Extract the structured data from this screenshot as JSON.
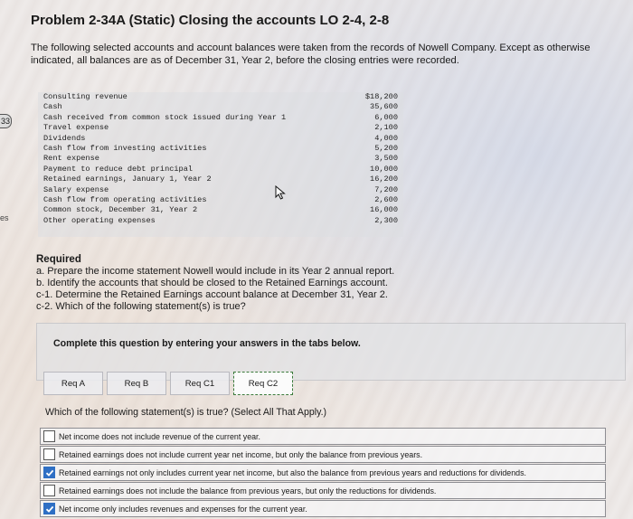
{
  "edge": {
    "num": "33",
    "label": "es"
  },
  "title": "Problem 2-34A (Static) Closing the accounts LO 2-4, 2-8",
  "intro": "The following selected accounts and account balances were taken from the records of Nowell Company. Except as otherwise indicated, all balances are as of December 31, Year 2, before the closing entries were recorded.",
  "accounts": [
    {
      "name": "Consulting revenue",
      "amount": "$18,200"
    },
    {
      "name": "Cash",
      "amount": "35,600"
    },
    {
      "name": "Cash received from common stock issued during Year 1",
      "amount": "6,000"
    },
    {
      "name": "Travel expense",
      "amount": "2,100"
    },
    {
      "name": "Dividends",
      "amount": "4,000"
    },
    {
      "name": "Cash flow from investing activities",
      "amount": "5,200"
    },
    {
      "name": "Rent expense",
      "amount": "3,500"
    },
    {
      "name": "Payment to reduce debt principal",
      "amount": "10,000"
    },
    {
      "name": "Retained earnings, January 1, Year 2",
      "amount": "16,200"
    },
    {
      "name": "Salary expense",
      "amount": "7,200"
    },
    {
      "name": "Cash flow from operating activities",
      "amount": "2,600"
    },
    {
      "name": "Common stock, December 31, Year 2",
      "amount": "16,000"
    },
    {
      "name": "Other operating expenses",
      "amount": "2,300"
    }
  ],
  "required": {
    "heading": "Required",
    "items": [
      "a. Prepare the income statement Nowell would include in its Year 2 annual report.",
      "b. Identify the accounts that should be closed to the Retained Earnings account.",
      "c-1. Determine the Retained Earnings account balance at December 31, Year 2.",
      "c-2. Which of the following statement(s) is true?"
    ]
  },
  "panel_text": "Complete this question by entering your answers in the tabs below.",
  "tabs": [
    {
      "label": "Req A",
      "active": false
    },
    {
      "label": "Req B",
      "active": false
    },
    {
      "label": "Req C1",
      "active": false
    },
    {
      "label": "Req C2",
      "active": true
    }
  ],
  "question": "Which of the following statement(s) is true? (Select All That Apply.)",
  "options": [
    {
      "text": "Net income does not include revenue of the current year.",
      "checked": false
    },
    {
      "text": "Retained earnings does not include current year net income, but only the balance from previous years.",
      "checked": false
    },
    {
      "text": "Retained earnings not only includes current year net income, but also the balance from previous years and reductions for dividends.",
      "checked": true
    },
    {
      "text": "Retained earnings does not include the balance from previous years, but only the reductions for dividends.",
      "checked": false
    },
    {
      "text": "Net income only includes revenues and expenses for the current year.",
      "checked": true
    }
  ],
  "colors": {
    "check": "#2f6fc4",
    "active_tab_border": "#3b7a3b"
  }
}
